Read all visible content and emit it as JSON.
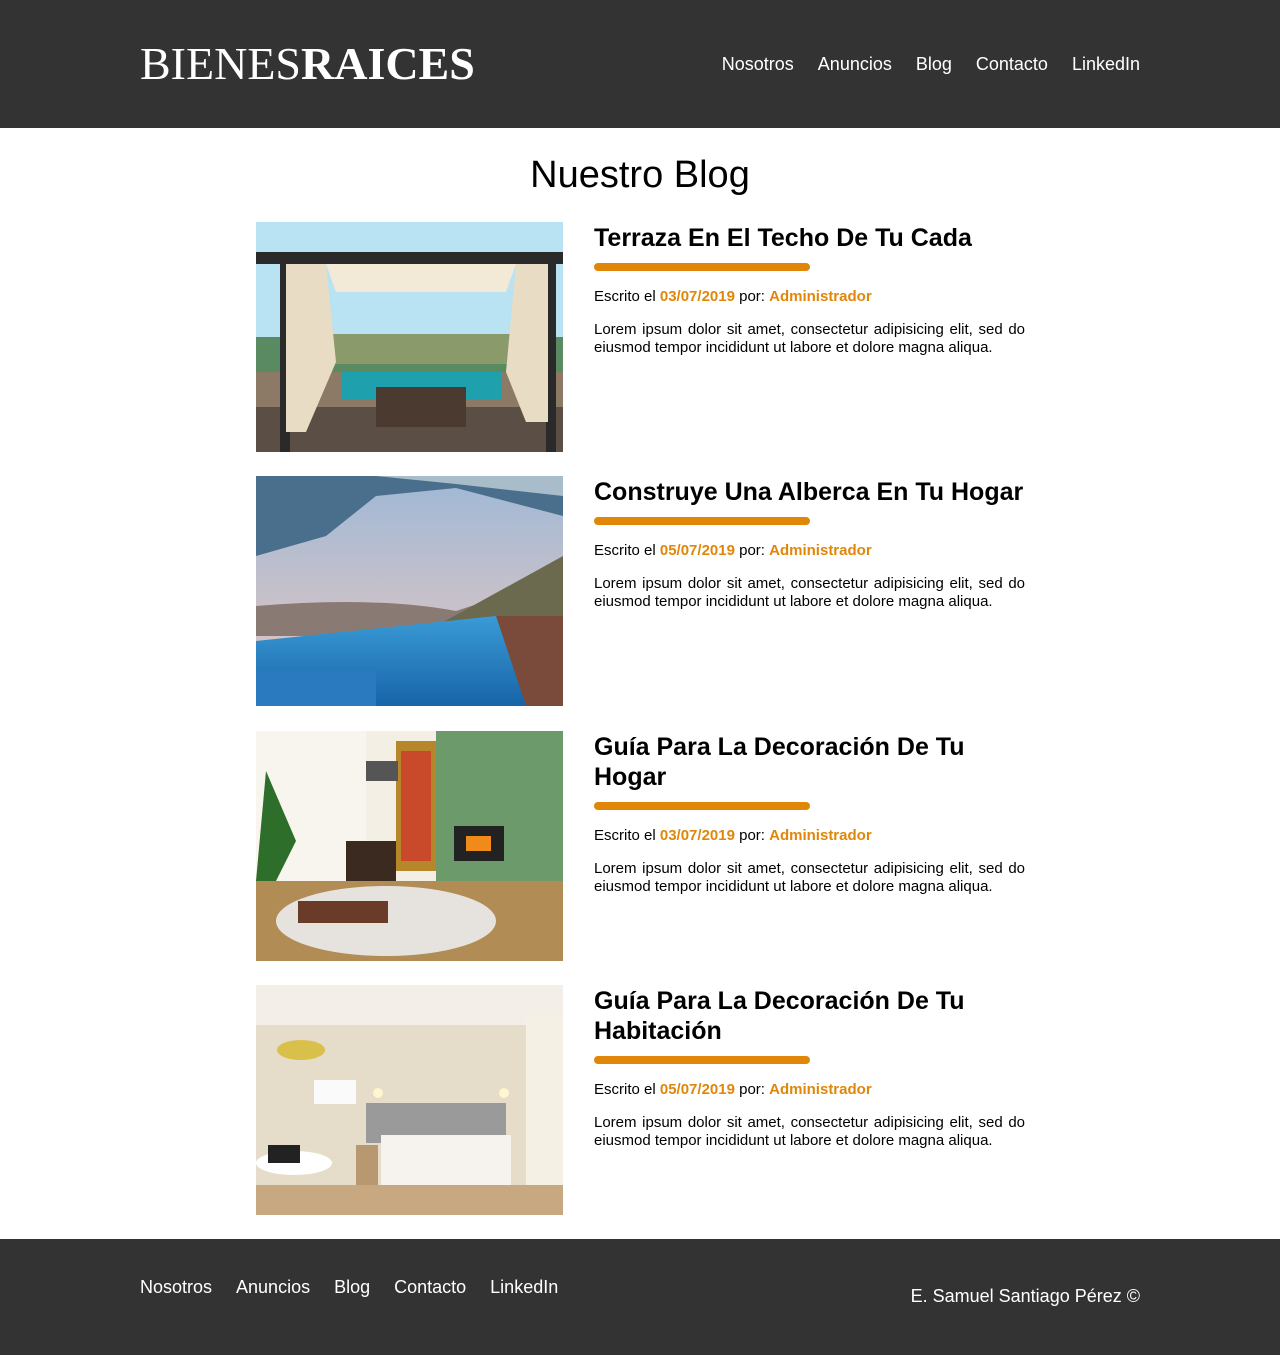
{
  "header": {
    "logo_thin": "BIENES",
    "logo_bold": "RAICES",
    "nav": [
      "Nosotros",
      "Anuncios",
      "Blog",
      "Contacto",
      "LinkedIn"
    ]
  },
  "main": {
    "title": "Nuestro Blog",
    "entries": [
      {
        "title": "Terraza En El Techo De Tu Cada",
        "meta_prefix": "Escrito el",
        "date": "03/07/2019",
        "by": "por:",
        "author": "Administrador",
        "excerpt": "Lorem ipsum dolor sit amet, consectetur adipisicing elit, sed do eiusmod tempor incididunt ut labore et dolore magna aliqua.",
        "image": "rooftop-terrace-image"
      },
      {
        "title": "Construye Una Alberca En Tu Hogar",
        "meta_prefix": "Escrito el",
        "date": "05/07/2019",
        "by": "por:",
        "author": "Administrador",
        "excerpt": "Lorem ipsum dolor sit amet, consectetur adipisicing elit, sed do eiusmod tempor incididunt ut labore et dolore magna aliqua.",
        "image": "infinity-pool-image"
      },
      {
        "title": "Guía Para La Decoración De Tu Hogar",
        "meta_prefix": "Escrito el",
        "date": "03/07/2019",
        "by": "por:",
        "author": "Administrador",
        "excerpt": "Lorem ipsum dolor sit amet, consectetur adipisicing elit, sed do eiusmod tempor incididunt ut labore et dolore magna aliqua.",
        "image": "living-room-image"
      },
      {
        "title": "Guía Para La Decoración De Tu Habitación",
        "meta_prefix": "Escrito el",
        "date": "05/07/2019",
        "by": "por:",
        "author": "Administrador",
        "excerpt": "Lorem ipsum dolor sit amet, consectetur adipisicing elit, sed do eiusmod tempor incididunt ut labore et dolore magna aliqua.",
        "image": "bedroom-image"
      }
    ]
  },
  "footer": {
    "nav": [
      "Nosotros",
      "Anuncios",
      "Blog",
      "Contacto",
      "LinkedIn"
    ],
    "copyright": "E. Samuel Santiago Pérez ©"
  },
  "colors": {
    "header_bg": "#333333",
    "accent": "#E08709",
    "text": "#000000"
  }
}
